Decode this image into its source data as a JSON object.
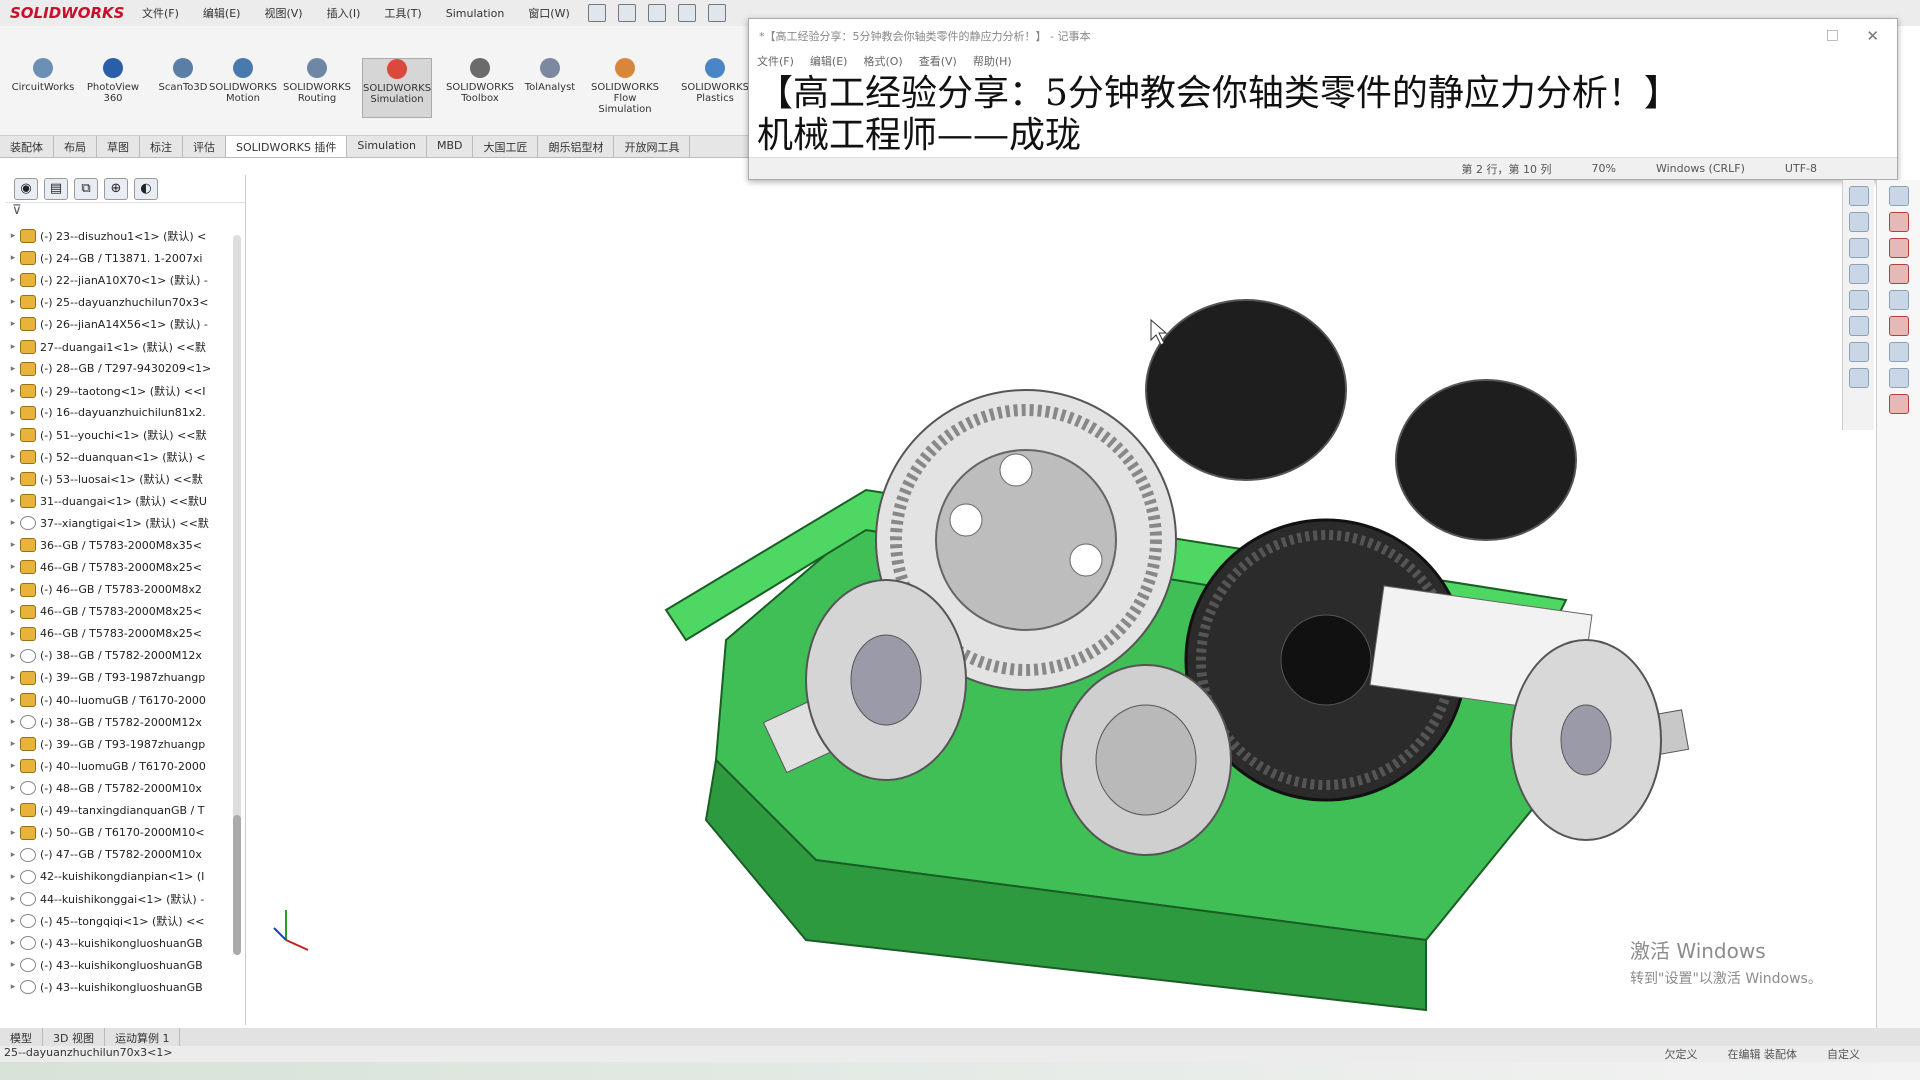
{
  "menubar": {
    "logo": "SOLIDWORKS",
    "items": [
      "文件(F)",
      "编辑(E)",
      "视图(V)",
      "插入(I)",
      "工具(T)",
      "Simulation",
      "窗口(W)"
    ]
  },
  "commands": [
    {
      "label": "CircuitWorks",
      "color": "#6b8fb5"
    },
    {
      "label": "PhotoView 360",
      "color": "#2a5ea8"
    },
    {
      "label": "ScanTo3D",
      "color": "#5a7fa6"
    },
    {
      "label": "SOLIDWORKS Motion",
      "color": "#4a79ad"
    },
    {
      "label": "SOLIDWORKS Routing",
      "color": "#6e87a5"
    },
    {
      "label": "SOLIDWORKS Simulation",
      "color": "#d94a3a"
    },
    {
      "label": "SOLIDWORKS Toolbox",
      "color": "#6b6b6b"
    },
    {
      "label": "TolAnalyst",
      "color": "#7b8aa0"
    },
    {
      "label": "SOLIDWORKS Flow Simulation",
      "color": "#d8873a"
    },
    {
      "label": "SOLIDWORKS Plastics",
      "color": "#4a86c5"
    }
  ],
  "tabs": [
    "装配体",
    "布局",
    "草图",
    "标注",
    "评估",
    "SOLIDWORKS 插件",
    "Simulation",
    "MBD",
    "大国工匠",
    "朗乐铝型材",
    "开放网工具"
  ],
  "tree": [
    {
      "label": "(-) 23--disuzhou1<1> (默认) <",
      "kind": "part"
    },
    {
      "label": "(-) 24--GB / T13871. 1-2007xi",
      "kind": "part"
    },
    {
      "label": "(-) 22--jianA10X70<1> (默认) -",
      "kind": "part"
    },
    {
      "label": "(-) 25--dayuanzhuchilun70x3<",
      "kind": "part"
    },
    {
      "label": "(-) 26--jianA14X56<1> (默认) -",
      "kind": "part"
    },
    {
      "label": "27--duangai1<1> (默认) <<默",
      "kind": "part"
    },
    {
      "label": "(-) 28--GB / T297-9430209<1>",
      "kind": "part"
    },
    {
      "label": "(-) 29--taotong<1> (默认) <<I",
      "kind": "part"
    },
    {
      "label": "(-) 16--dayuanzhuichilun81x2.",
      "kind": "part"
    },
    {
      "label": "(-) 51--youchi<1> (默认) <<默",
      "kind": "part"
    },
    {
      "label": "(-) 52--duanquan<1> (默认) <",
      "kind": "part"
    },
    {
      "label": "(-) 53--luosai<1> (默认) <<默",
      "kind": "part"
    },
    {
      "label": "31--duangai<1> (默认) <<默U",
      "kind": "part"
    },
    {
      "label": "37--xiangtigai<1> (默认) <<默",
      "kind": "part2"
    },
    {
      "label": "36--GB / T5783-2000M8x35<",
      "kind": "part"
    },
    {
      "label": "46--GB / T5783-2000M8x25<",
      "kind": "part"
    },
    {
      "label": "(-) 46--GB / T5783-2000M8x2",
      "kind": "part"
    },
    {
      "label": "46--GB / T5783-2000M8x25<",
      "kind": "part"
    },
    {
      "label": "46--GB / T5783-2000M8x25<",
      "kind": "part"
    },
    {
      "label": "(-) 38--GB / T5782-2000M12x",
      "kind": "part2"
    },
    {
      "label": "(-) 39--GB / T93-1987zhuangp",
      "kind": "part"
    },
    {
      "label": "(-) 40--luomuGB / T6170-2000",
      "kind": "part"
    },
    {
      "label": "(-) 38--GB / T5782-2000M12x",
      "kind": "part2"
    },
    {
      "label": "(-) 39--GB / T93-1987zhuangp",
      "kind": "part"
    },
    {
      "label": "(-) 40--luomuGB / T6170-2000",
      "kind": "part"
    },
    {
      "label": "(-) 48--GB / T5782-2000M10x",
      "kind": "part2"
    },
    {
      "label": "(-) 49--tanxingdianquanGB / T",
      "kind": "part"
    },
    {
      "label": "(-) 50--GB / T6170-2000M10<",
      "kind": "part"
    },
    {
      "label": "(-) 47--GB / T5782-2000M10x",
      "kind": "part2"
    },
    {
      "label": "42--kuishikongdianpian<1> (I",
      "kind": "part2"
    },
    {
      "label": "44--kuishikonggai<1> (默认) -",
      "kind": "part2"
    },
    {
      "label": "(-) 45--tongqiqi<1> (默认) <<",
      "kind": "part2"
    },
    {
      "label": "(-) 43--kuishikongluoshuanGB",
      "kind": "part2"
    },
    {
      "label": "(-) 43--kuishikongluoshuanGB",
      "kind": "part2"
    },
    {
      "label": "(-) 43--kuishikongluoshuanGB",
      "kind": "part2"
    }
  ],
  "notepad": {
    "title": "*【高工经验分享：5分钟教会你轴类零件的静应力分析！】 - 记事本",
    "menu": [
      "文件(F)",
      "编辑(E)",
      "格式(O)",
      "查看(V)",
      "帮助(H)"
    ],
    "line1": "【高工经验分享：5分钟教会你轴类零件的静应力分析！】",
    "line2": "机械工程师——成珑",
    "status": {
      "position": "第 2 行，第 10 列",
      "zoom": "70%",
      "eol": "Windows (CRLF)",
      "encoding": "UTF-8"
    }
  },
  "bottom_tabs": [
    "模型",
    "3D 视图",
    "运动算例 1"
  ],
  "statusbar": {
    "left": "25--dayuanzhuchilun70x3<1>",
    "right": [
      "欠定义",
      "在编辑 装配体",
      "自定义"
    ]
  },
  "activation": {
    "title": "激活 Windows",
    "subtitle": "转到\"设置\"以激活 Windows。"
  },
  "colors": {
    "housing": "#4fd764",
    "housing_dark": "#2e9a3f",
    "gear_light": "#bdbdbd",
    "gear_dark": "#2b2b2b"
  }
}
